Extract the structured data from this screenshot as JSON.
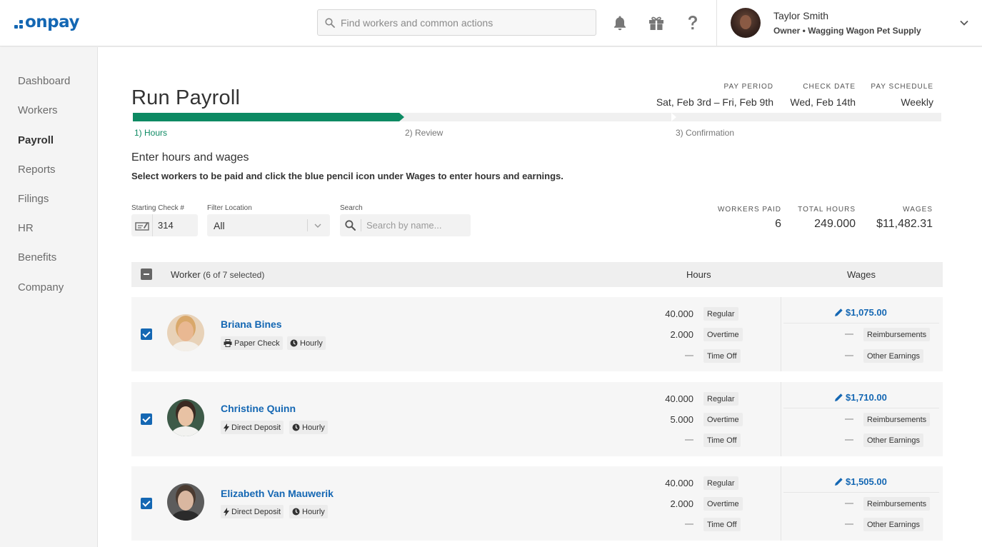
{
  "brand": {
    "name": "onpay",
    "color": "#1467b3"
  },
  "header": {
    "search_placeholder": "Find workers and common actions",
    "icons": [
      "bell-icon",
      "gift-icon",
      "help-icon"
    ],
    "user": {
      "name": "Taylor Smith",
      "role": "Owner • Wagging Wagon Pet Supply"
    }
  },
  "sidebar": {
    "items": [
      {
        "label": "Dashboard",
        "active": false
      },
      {
        "label": "Workers",
        "active": false
      },
      {
        "label": "Payroll",
        "active": true
      },
      {
        "label": "Reports",
        "active": false
      },
      {
        "label": "Filings",
        "active": false
      },
      {
        "label": "HR",
        "active": false
      },
      {
        "label": "Benefits",
        "active": false
      },
      {
        "label": "Company",
        "active": false
      }
    ]
  },
  "page": {
    "title": "Run Payroll",
    "meta": {
      "pay_period_label": "PAY PERIOD",
      "pay_period": "Sat, Feb 3rd – Fri, Feb 9th",
      "check_date_label": "CHECK DATE",
      "check_date": "Wed, Feb 14th",
      "pay_schedule_label": "PAY SCHEDULE",
      "pay_schedule": "Weekly"
    },
    "steps": [
      "1) Hours",
      "2) Review",
      "3) Confirmation"
    ],
    "active_step": 1,
    "progress_color": "#0d8a63",
    "section_title": "Enter hours and wages",
    "section_sub": "Select workers to be paid and click the blue pencil icon under Wages to enter hours and earnings.",
    "filters": {
      "check_label": "Starting Check #",
      "check_value": "314",
      "location_label": "Filter Location",
      "location_value": "All",
      "search_label": "Search",
      "search_placeholder": "Search by name..."
    },
    "stats": {
      "workers_paid_label": "WORKERS PAID",
      "workers_paid": "6",
      "total_hours_label": "TOTAL HOURS",
      "total_hours": "249.000",
      "wages_label": "WAGES",
      "wages": "$11,482.31"
    },
    "table": {
      "worker_header": "Worker",
      "worker_count": "(6 of 7 selected)",
      "hours_header": "Hours",
      "wages_header": "Wages",
      "rows": [
        {
          "name": "Briana Bines",
          "pay_method": "Paper Check",
          "pay_type": "Hourly",
          "regular": "40.000",
          "overtime": "2.000",
          "regular_label": "Regular",
          "overtime_label": "Overtime",
          "timeoff_label": "Time Off",
          "wage": "$1,075.00",
          "reimb_label": "Reimbursements",
          "other_label": "Other Earnings"
        },
        {
          "name": "Christine Quinn",
          "pay_method": "Direct Deposit",
          "pay_type": "Hourly",
          "regular": "40.000",
          "overtime": "5.000",
          "regular_label": "Regular",
          "overtime_label": "Overtime",
          "timeoff_label": "Time Off",
          "wage": "$1,710.00",
          "reimb_label": "Reimbursements",
          "other_label": "Other Earnings"
        },
        {
          "name": "Elizabeth Van Mauwerik",
          "pay_method": "Direct Deposit",
          "pay_type": "Hourly",
          "regular": "40.000",
          "overtime": "2.000",
          "regular_label": "Regular",
          "overtime_label": "Overtime",
          "timeoff_label": "Time Off",
          "wage": "$1,505.00",
          "reimb_label": "Reimbursements",
          "other_label": "Other Earnings"
        }
      ]
    }
  }
}
